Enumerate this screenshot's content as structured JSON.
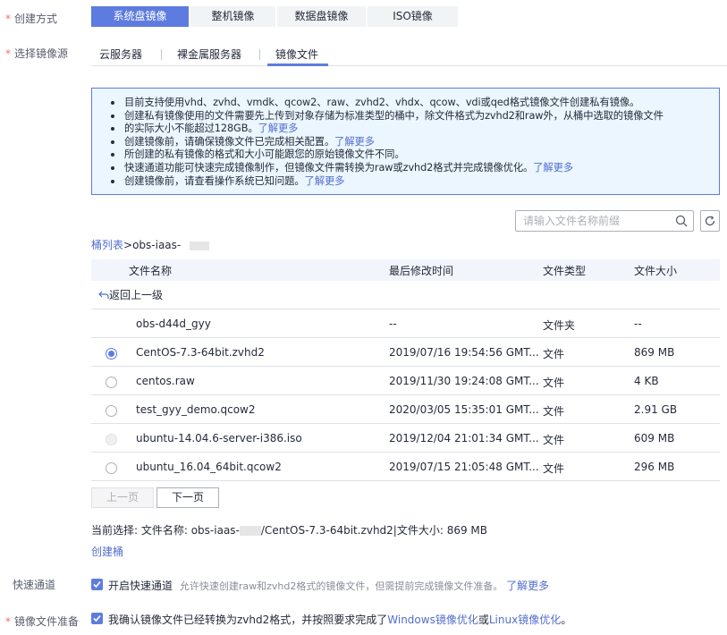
{
  "creation": {
    "label": "创建方式",
    "options": [
      "系统盘镜像",
      "整机镜像",
      "数据盘镜像",
      "ISO镜像"
    ],
    "selected": "系统盘镜像"
  },
  "source": {
    "label": "选择镜像源",
    "tabs": [
      "云服务器",
      "裸金属服务器",
      "镜像文件"
    ],
    "active_tab": "镜像文件"
  },
  "notice": {
    "items": [
      {
        "text": "目前支持使用vhd、zvhd、vmdk、qcow2、raw、zvhd2、vhdx、qcow、vdi或qed格式镜像文件创建私有镜像。",
        "link": ""
      },
      {
        "text": "创建私有镜像使用的文件需要先上传到对象存储为标准类型的桶中，除文件格式为zvhd2和raw外，从桶中选取的镜像文件",
        "link": ""
      },
      {
        "text": "的实际大小不能超过128GB。",
        "link": "了解更多"
      },
      {
        "text": "创建镜像前，请确保镜像文件已完成相关配置。",
        "link": "了解更多"
      },
      {
        "text": "所创建的私有镜像的格式和大小可能跟您的原始镜像文件不同。",
        "link": ""
      },
      {
        "text": "快速通道功能可快速完成镜像制作，但镜像文件需转换为raw或zvhd2格式并完成镜像优化。",
        "link": "了解更多"
      },
      {
        "text": "创建镜像前，请查看操作系统已知问题。",
        "link": "了解更多"
      }
    ]
  },
  "search": {
    "placeholder": "请输入文件名称前缀",
    "icon": "search-icon",
    "refresh_icon": "refresh-icon"
  },
  "breadcrumb": {
    "root": "桶列表",
    "separator": ">",
    "current": "obs-iaas-"
  },
  "table": {
    "columns": [
      "文件名称",
      "最后修改时间",
      "文件类型",
      "文件大小"
    ],
    "back_label": "返回上一级",
    "rows": [
      {
        "name": "obs-d44d_gyy",
        "modified": "--",
        "type": "文件夹",
        "size": "--",
        "radio": "none",
        "is_link": true
      },
      {
        "name": "CentOS-7.3-64bit.zvhd2",
        "modified": "2019/07/16 19:54:56 GMT...",
        "type": "文件",
        "size": "869 MB",
        "radio": "checked",
        "is_link": false
      },
      {
        "name": "centos.raw",
        "modified": "2019/11/30 19:24:08 GMT...",
        "type": "文件",
        "size": "4 KB",
        "radio": "unchecked",
        "is_link": false
      },
      {
        "name": "test_gyy_demo.qcow2",
        "modified": "2020/03/05 15:35:01 GMT...",
        "type": "文件",
        "size": "2.91 GB",
        "radio": "unchecked",
        "is_link": false
      },
      {
        "name": "ubuntu-14.04.6-server-i386.iso",
        "modified": "2019/12/04 21:01:34 GMT...",
        "type": "文件",
        "size": "609 MB",
        "radio": "disabled",
        "is_link": false
      },
      {
        "name": "ubuntu_16.04_64bit.qcow2",
        "modified": "2019/07/15 21:05:48 GMT...",
        "type": "文件",
        "size": "296 MB",
        "radio": "unchecked",
        "is_link": false
      }
    ]
  },
  "pagination": {
    "prev": "上一页",
    "next": "下一页"
  },
  "selection": {
    "prefix": "当前选择: 文件名称: obs-iaas-",
    "suffix": "/CentOS-7.3-64bit.zvhd2|文件大小: 869 MB"
  },
  "create_bucket": "创建桶",
  "fast_track": {
    "label": "快速通道",
    "checkbox_label": "开启快速通道",
    "description": "允许快速创建raw和zvhd2格式的镜像文件，但需提前完成镜像文件准备。",
    "link": "了解更多",
    "checked": true
  },
  "prep": {
    "label": "镜像文件准备",
    "text_before": "我确认镜像文件已经转换为zvhd2格式，并按照要求完成了",
    "link1": "Windows镜像优化",
    "middle": "或",
    "link2": "Linux镜像优化",
    "end": "。",
    "checked": true
  },
  "colors": {
    "accent": "#5e7ce0",
    "link": "#526ecc",
    "required": "#f66f6a",
    "notice_bg": "#ebf6ff"
  }
}
